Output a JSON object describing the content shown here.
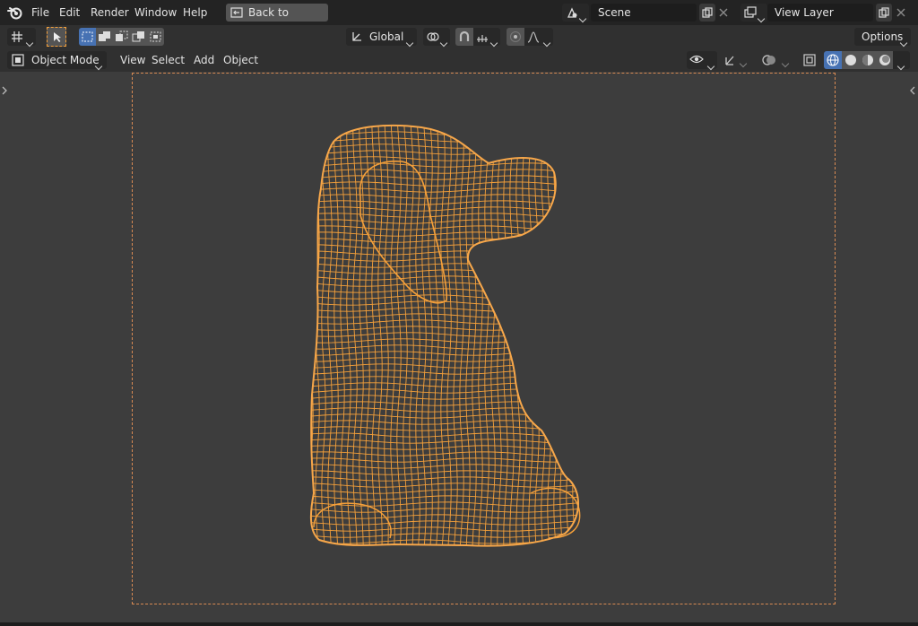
{
  "menu": {
    "items": [
      "File",
      "Edit",
      "Render",
      "Window",
      "Help"
    ],
    "back_button": "Back to Previous"
  },
  "scene": {
    "label": "Scene"
  },
  "view_layer": {
    "label": "View Layer"
  },
  "toolbar": {
    "orientation": "Global",
    "options_label": "Options"
  },
  "header": {
    "mode": "Object Mode",
    "menus": [
      "View",
      "Select",
      "Add",
      "Object"
    ]
  },
  "colors": {
    "accent": "#f5a03a",
    "selected_blue": "#4772b3",
    "viewport_bg": "#3d3d3d",
    "header_bg": "#303030"
  },
  "icons": [
    "blender-logo-icon",
    "back-arrow-icon",
    "scene-icon",
    "copy-icon",
    "close-icon",
    "view-layer-icon",
    "snap-icon",
    "proportional-icon",
    "cursor-select-icon",
    "gizmo-icon",
    "overlay-icon",
    "xray-icon",
    "wireframe-shading-icon",
    "solid-shading-icon",
    "material-shading-icon",
    "rendered-shading-icon"
  ]
}
